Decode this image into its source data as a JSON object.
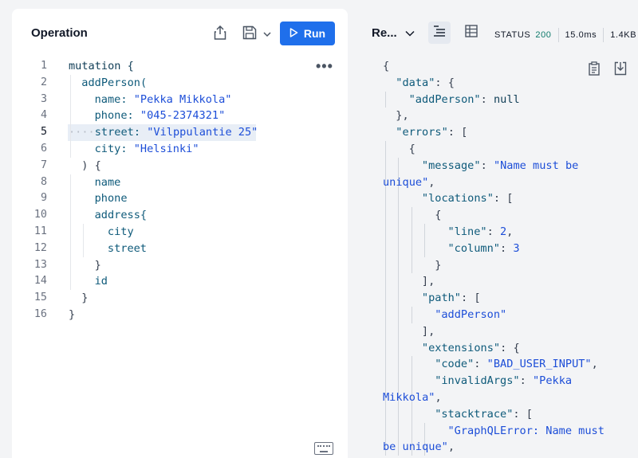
{
  "operation": {
    "title": "Operation",
    "run_label": "Run",
    "lines": [
      {
        "n": "1",
        "parts": [
          {
            "t": "mutation {",
            "c": "kw"
          }
        ]
      },
      {
        "n": "2",
        "parts": [
          {
            "t": "addPerson(",
            "c": "fld"
          }
        ]
      },
      {
        "n": "3",
        "parts": [
          {
            "t": "name: ",
            "c": "fld"
          },
          {
            "t": "\"Pekka Mikkola\"",
            "c": "str"
          }
        ]
      },
      {
        "n": "4",
        "parts": [
          {
            "t": "phone: ",
            "c": "fld"
          },
          {
            "t": "\"045-2374321\"",
            "c": "str"
          }
        ]
      },
      {
        "n": "5",
        "parts": [
          {
            "t": "street: ",
            "c": "fld"
          },
          {
            "t": "\"Vilppulantie 25\"",
            "c": "str"
          }
        ]
      },
      {
        "n": "6",
        "parts": [
          {
            "t": "city: ",
            "c": "fld"
          },
          {
            "t": "\"Helsinki\"",
            "c": "str"
          }
        ]
      },
      {
        "n": "7",
        "parts": [
          {
            "t": ") {",
            "c": "punc"
          }
        ]
      },
      {
        "n": "8",
        "parts": [
          {
            "t": "name",
            "c": "fld"
          }
        ]
      },
      {
        "n": "9",
        "parts": [
          {
            "t": "phone",
            "c": "fld"
          }
        ]
      },
      {
        "n": "10",
        "parts": [
          {
            "t": "address{",
            "c": "fld"
          }
        ]
      },
      {
        "n": "11",
        "parts": [
          {
            "t": "city",
            "c": "fld"
          }
        ]
      },
      {
        "n": "12",
        "parts": [
          {
            "t": "street",
            "c": "fld"
          }
        ]
      },
      {
        "n": "13",
        "parts": [
          {
            "t": "}",
            "c": "punc"
          }
        ]
      },
      {
        "n": "14",
        "parts": [
          {
            "t": "id",
            "c": "fld"
          }
        ]
      },
      {
        "n": "15",
        "parts": [
          {
            "t": "}",
            "c": "punc"
          }
        ]
      },
      {
        "n": "16",
        "parts": [
          {
            "t": "}",
            "c": "punc"
          }
        ]
      }
    ],
    "active_line": "5"
  },
  "response": {
    "title": "Re...",
    "status_label": "STATUS",
    "status_code": "200",
    "time": "15.0ms",
    "size": "1.4KB",
    "lines": [
      [
        {
          "t": "{",
          "c": "punc"
        }
      ],
      [
        {
          "t": "\"data\"",
          "c": "rkey"
        },
        {
          "t": ": {",
          "c": "punc"
        }
      ],
      [
        {
          "t": "\"addPerson\"",
          "c": "rkey"
        },
        {
          "t": ": ",
          "c": "punc"
        },
        {
          "t": "null",
          "c": "rnull"
        }
      ],
      [
        {
          "t": "},",
          "c": "punc"
        }
      ],
      [
        {
          "t": "\"errors\"",
          "c": "rkey"
        },
        {
          "t": ": [",
          "c": "punc"
        }
      ],
      [
        {
          "t": "{",
          "c": "punc"
        }
      ],
      [
        {
          "t": "\"message\"",
          "c": "rkey"
        },
        {
          "t": ": ",
          "c": "punc"
        },
        {
          "t": "\"Name must be",
          "c": "rval"
        }
      ],
      [
        {
          "t": "unique\"",
          "c": "rval"
        },
        {
          "t": ",",
          "c": "punc"
        }
      ],
      [
        {
          "t": "\"locations\"",
          "c": "rkey"
        },
        {
          "t": ": [",
          "c": "punc"
        }
      ],
      [
        {
          "t": "{",
          "c": "punc"
        }
      ],
      [
        {
          "t": "\"line\"",
          "c": "rkey"
        },
        {
          "t": ": ",
          "c": "punc"
        },
        {
          "t": "2",
          "c": "rval"
        },
        {
          "t": ",",
          "c": "punc"
        }
      ],
      [
        {
          "t": "\"column\"",
          "c": "rkey"
        },
        {
          "t": ": ",
          "c": "punc"
        },
        {
          "t": "3",
          "c": "rval"
        }
      ],
      [
        {
          "t": "}",
          "c": "punc"
        }
      ],
      [
        {
          "t": "],",
          "c": "punc"
        }
      ],
      [
        {
          "t": "\"path\"",
          "c": "rkey"
        },
        {
          "t": ": [",
          "c": "punc"
        }
      ],
      [
        {
          "t": "\"addPerson\"",
          "c": "rval"
        }
      ],
      [
        {
          "t": "],",
          "c": "punc"
        }
      ],
      [
        {
          "t": "\"extensions\"",
          "c": "rkey"
        },
        {
          "t": ": {",
          "c": "punc"
        }
      ],
      [
        {
          "t": "\"code\"",
          "c": "rkey"
        },
        {
          "t": ": ",
          "c": "punc"
        },
        {
          "t": "\"BAD_USER_INPUT\"",
          "c": "rval"
        },
        {
          "t": ",",
          "c": "punc"
        }
      ],
      [
        {
          "t": "\"invalidArgs\"",
          "c": "rkey"
        },
        {
          "t": ": ",
          "c": "punc"
        },
        {
          "t": "\"Pekka",
          "c": "rval"
        }
      ],
      [
        {
          "t": "Mikkola\"",
          "c": "rval"
        },
        {
          "t": ",",
          "c": "punc"
        }
      ],
      [
        {
          "t": "\"stacktrace\"",
          "c": "rkey"
        },
        {
          "t": ": [",
          "c": "punc"
        }
      ],
      [
        {
          "t": "\"GraphQLError: Name must",
          "c": "rval"
        }
      ],
      [
        {
          "t": "be unique\"",
          "c": "rval"
        },
        {
          "t": ",",
          "c": "punc"
        }
      ]
    ]
  }
}
